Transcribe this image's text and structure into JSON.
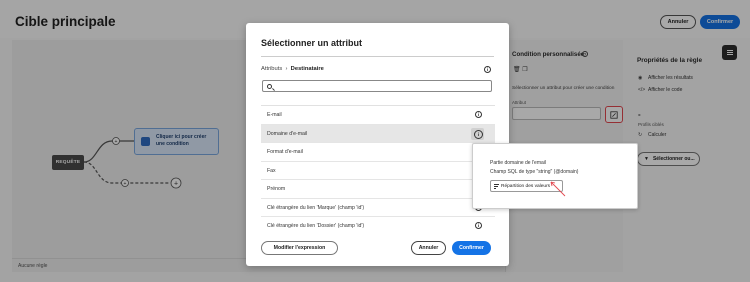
{
  "page": {
    "title": "Cible principale",
    "top_buttons": {
      "cancel": "Annuler",
      "confirm": "Confirmer"
    }
  },
  "canvas": {
    "start_node": "REQUÊTE",
    "condition_node": "Cliquer ici pour créer une condition",
    "footer": "Aucune règle"
  },
  "condition_panel": {
    "title": "Condition personnalisée",
    "hint": "Sélectionner un attribut pour créer une condition",
    "attribute_label": "Attribut"
  },
  "rule_panel": {
    "title": "Propriétés de la règle",
    "show_results": "Afficher les résultats",
    "show_code": "Afficher le code",
    "count_value": "-",
    "profiles_label": "Profils ciblés",
    "calculate": "Calculer",
    "select_button": "Sélectionner ou..."
  },
  "modal": {
    "title": "Sélectionner un attribut",
    "breadcrumb_root": "Attributs",
    "breadcrumb_current": "Destinataire",
    "search_placeholder": "",
    "attributes": [
      "E-mail",
      "Domaine d'e-mail",
      "Format d'e-mail",
      "Fax",
      "Prénom",
      "Clé étrangère du lien 'Marque' (champ 'id')",
      "Clé étrangère du lien 'Dossier' (champ 'id')"
    ],
    "selected_index": 1,
    "buttons": {
      "modify_expression": "Modifier l'expression",
      "cancel": "Annuler",
      "confirm": "Confirmer"
    }
  },
  "popover": {
    "title": "Partie domaine de l'email",
    "description": "Champ SQL de type \"string\" (@domain)",
    "button": "Répartition des valeurs"
  },
  "colors": {
    "accent": "#1473e6",
    "highlight": "#e34850",
    "overlay": "rgba(0,0,0,0.34)"
  }
}
